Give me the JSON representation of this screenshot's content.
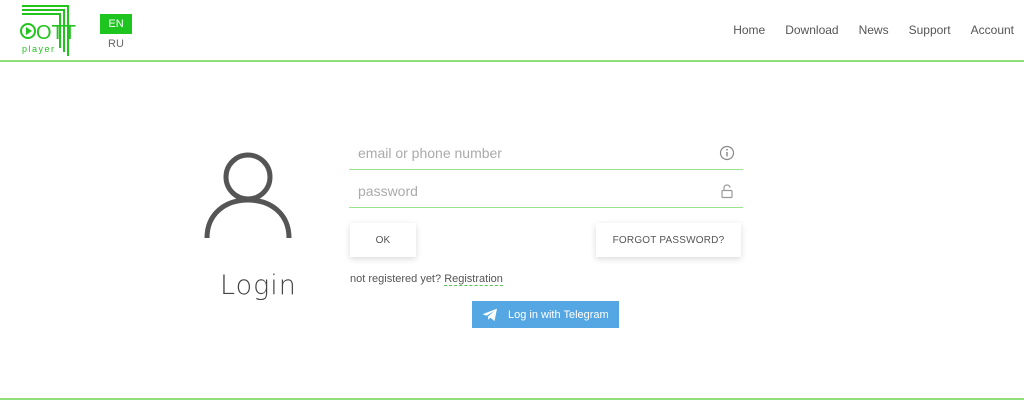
{
  "logo": {
    "brand_main": "OTT",
    "brand_sub": "player"
  },
  "languages": {
    "active": "EN",
    "other": "RU"
  },
  "nav": {
    "home": "Home",
    "download": "Download",
    "news": "News",
    "support": "Support",
    "account": "Account"
  },
  "login": {
    "title": "Login",
    "email_placeholder": "email or phone number",
    "password_placeholder": "password",
    "ok_label": "OK",
    "forgot_label": "FORGOT PASSWORD?",
    "not_registered_text": "not registered yet?",
    "registration_link": "Registration",
    "telegram_label": "Log in with Telegram"
  },
  "colors": {
    "accent_green": "#1ec51e",
    "line_green": "#8fe07a",
    "telegram_blue": "#55a7e3"
  },
  "icons": {
    "email_field": "info-icon",
    "password_field": "lock-icon",
    "telegram": "telegram-icon",
    "avatar": "user-icon"
  }
}
